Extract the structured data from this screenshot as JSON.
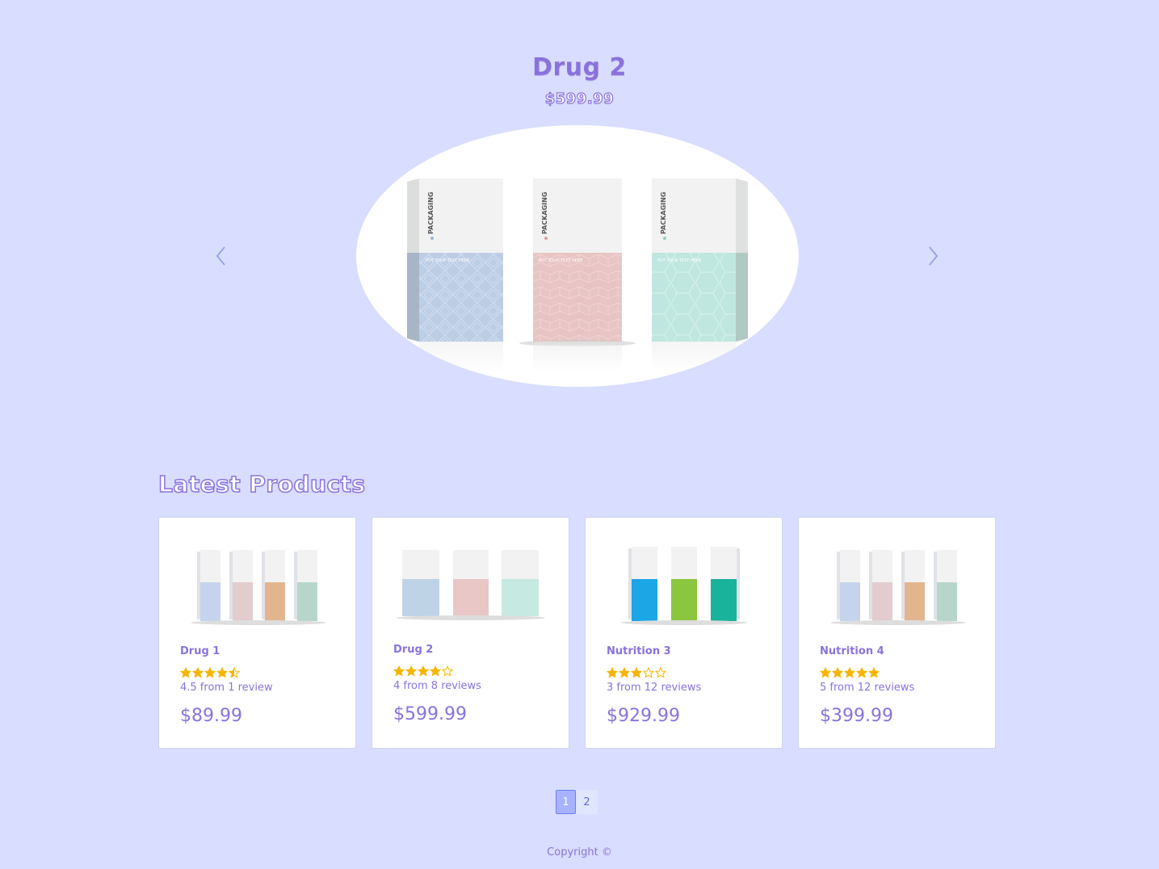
{
  "colors": {
    "background": "#d9ddff",
    "accent": "#8a72dc",
    "star": "#f7b500",
    "card_bg": "#ffffff",
    "page_active": "#a7b3ff"
  },
  "carousel": {
    "title": "Drug 2",
    "price": "$599.99",
    "image_text": "PACKAGING",
    "image_subtext": "PUT YOUR TEXT HERE",
    "prev_icon": "chevron-left-icon",
    "next_icon": "chevron-right-icon"
  },
  "latest": {
    "heading": "Latest Products",
    "products": [
      {
        "name": "Drug 1",
        "rating": 4.5,
        "reviews": "4.5 from 1 review",
        "price": "$89.99"
      },
      {
        "name": "Drug 2",
        "rating": 4,
        "reviews": "4 from 8 reviews",
        "price": "$599.99"
      },
      {
        "name": "Nutrition 3",
        "rating": 3,
        "reviews": "3 from 12 reviews",
        "price": "$929.99"
      },
      {
        "name": "Nutrition 4",
        "rating": 5,
        "reviews": "5 from 12 reviews",
        "price": "$399.99"
      }
    ]
  },
  "pagination": {
    "pages": [
      "1",
      "2"
    ],
    "current": "1"
  },
  "footer": {
    "text": "Copyright ©"
  }
}
